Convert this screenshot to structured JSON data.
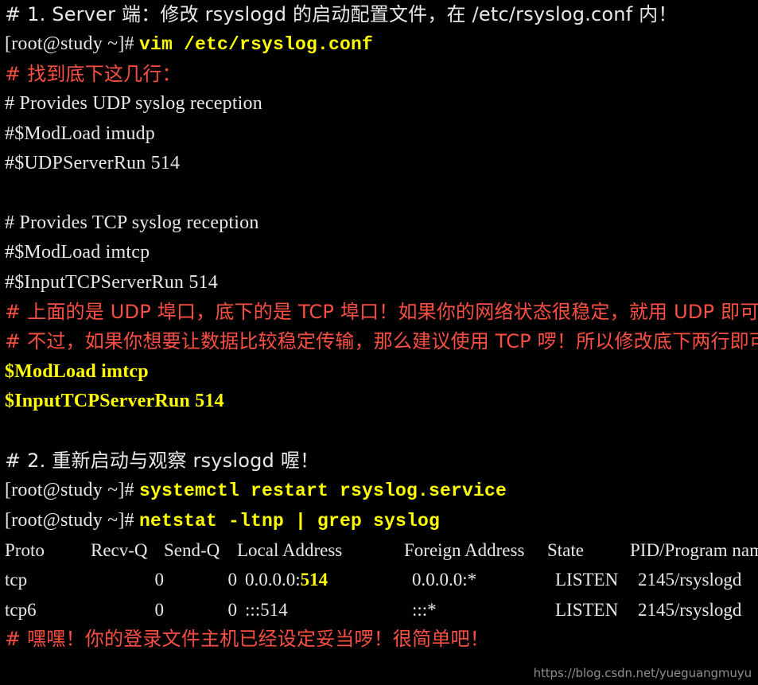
{
  "terminal": {
    "background_color": "#000000",
    "white_color": "#e8e8ec",
    "yellow_color": "#ffff00",
    "red_color": "#fc4f43",
    "lines": [
      {
        "id": "l01",
        "kind": "comment-white",
        "text": "# 1. Server 端：修改 rsyslogd 的启动配置文件，在 /etc/rsyslog.conf 内！"
      },
      {
        "id": "l02",
        "kind": "prompt-command",
        "prompt": "[root@study ~]# ",
        "command": "vim /etc/rsyslog.conf"
      },
      {
        "id": "l03",
        "kind": "comment-red",
        "text": "# 找到底下这几行："
      },
      {
        "id": "l04",
        "kind": "conf-white",
        "text": "# Provides UDP syslog reception"
      },
      {
        "id": "l05",
        "kind": "conf-white",
        "text": "#$ModLoad imudp"
      },
      {
        "id": "l06",
        "kind": "conf-white",
        "text": "#$UDPServerRun 514"
      },
      {
        "id": "l07",
        "kind": "blank",
        "text": ""
      },
      {
        "id": "l08",
        "kind": "conf-white",
        "text": "# Provides TCP syslog reception"
      },
      {
        "id": "l09",
        "kind": "conf-white",
        "text": "#$ModLoad imtcp"
      },
      {
        "id": "l10",
        "kind": "conf-white",
        "text": "#$InputTCPServerRun 514"
      },
      {
        "id": "l11",
        "kind": "comment-red",
        "text": "# 上面的是 UDP 埠口，底下的是 TCP 埠口！如果你的网络状态很稳定，就用 UDP 即可。"
      },
      {
        "id": "l12",
        "kind": "comment-red",
        "text": "# 不过，如果你想要让数据比较稳定传输，那么建议使用 TCP 啰！所以修改底下两行即可！"
      },
      {
        "id": "l13",
        "kind": "conf-yellow",
        "text": "$ModLoad imtcp"
      },
      {
        "id": "l14",
        "kind": "conf-yellow",
        "text": "$InputTCPServerRun 514"
      },
      {
        "id": "l15",
        "kind": "blank",
        "text": ""
      },
      {
        "id": "l16",
        "kind": "comment-white",
        "text": "# 2. 重新启动与观察 rsyslogd 喔！"
      },
      {
        "id": "l17",
        "kind": "prompt-command",
        "prompt": "[root@study ~]# ",
        "command": "systemctl restart rsyslog.service"
      },
      {
        "id": "l18",
        "kind": "prompt-command",
        "prompt": "[root@study ~]# ",
        "command": "netstat -ltnp | grep syslog"
      }
    ],
    "netstat": {
      "headers": {
        "proto": "Proto",
        "recvq": "Recv-Q",
        "sendq": "Send-Q",
        "local": "Local Address",
        "foreign": "Foreign Address",
        "state": "State",
        "pid": "PID/Program name"
      },
      "rows": [
        {
          "proto": "tcp",
          "recvq": "0",
          "sendq": "0",
          "local_prefix": "0.0.0.0:",
          "local_port": "514",
          "local_port_highlighted": true,
          "foreign": "0.0.0.0:*",
          "state": "LISTEN",
          "pid": "2145/rsyslogd"
        },
        {
          "proto": "tcp6",
          "recvq": "0",
          "sendq": "0",
          "local_prefix": ":::514",
          "local_port": "",
          "local_port_highlighted": false,
          "foreign": ":::*",
          "state": "LISTEN",
          "pid": "2145/rsyslogd"
        }
      ]
    },
    "final_comment": "# 嘿嘿！你的登录文件主机已经设定妥当啰！很简单吧！",
    "watermark": "https://blog.csdn.net/yueguangmuyu"
  }
}
